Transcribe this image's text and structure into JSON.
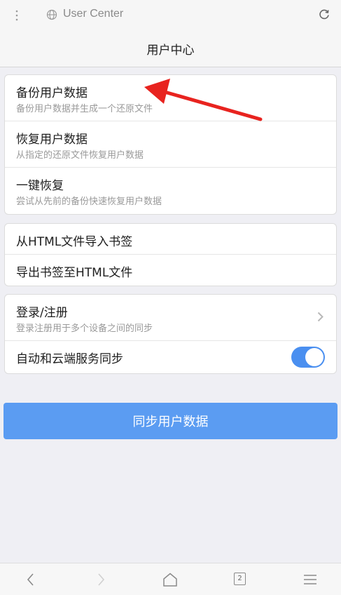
{
  "address_bar": {
    "url_text": "User Center",
    "menu_icon": "more-vert-icon",
    "site_icon": "globe-icon",
    "refresh_icon": "refresh-icon"
  },
  "header": {
    "title": "用户中心"
  },
  "group_backup": [
    {
      "title": "备份用户数据",
      "subtitle": "备份用户数据并生成一个还原文件"
    },
    {
      "title": "恢复用户数据",
      "subtitle": "从指定的还原文件恢复用户数据"
    },
    {
      "title": "一键恢复",
      "subtitle": "尝试从先前的备份快速恢复用户数据"
    }
  ],
  "group_bookmarks": [
    {
      "title": "从HTML文件导入书签"
    },
    {
      "title": "导出书签至HTML文件"
    }
  ],
  "group_account": {
    "login": {
      "title": "登录/注册",
      "subtitle": "登录注册用于多个设备之间的同步"
    },
    "auto_sync": {
      "title": "自动和云端服务同步",
      "enabled": true
    }
  },
  "sync_button": {
    "label": "同步用户数据"
  },
  "bottom_nav": {
    "tab_count": "2",
    "icons": [
      "back-icon",
      "forward-icon",
      "home-icon",
      "tabs-icon",
      "menu-icon"
    ]
  },
  "colors": {
    "accent": "#5b9cf2",
    "toggle": "#4a8ff0",
    "annotation_arrow": "#e8231f"
  }
}
